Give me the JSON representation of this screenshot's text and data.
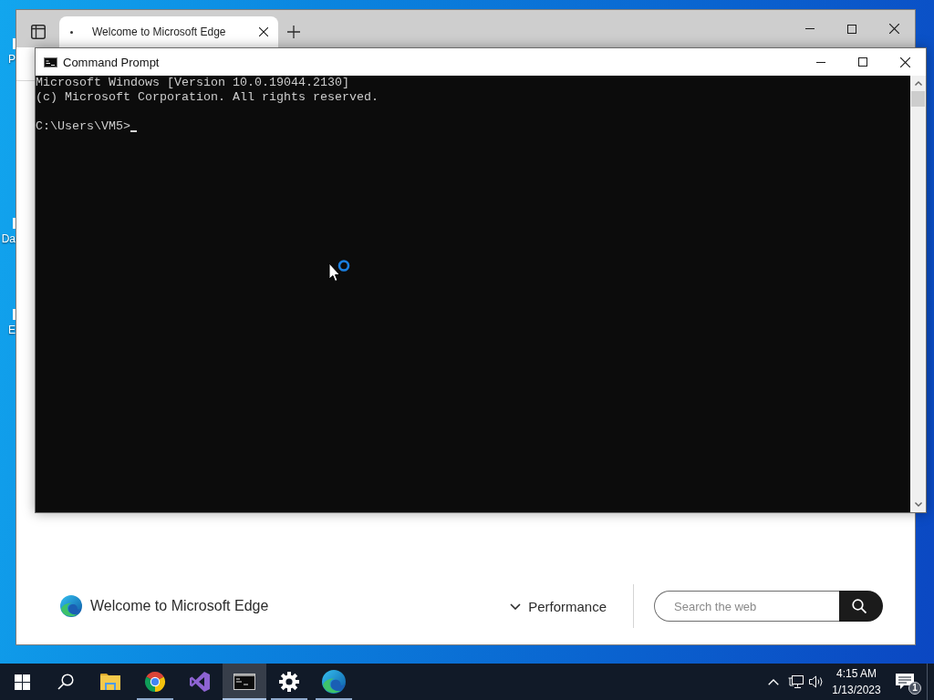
{
  "desktop": {
    "icons": [
      {
        "label": "P"
      },
      {
        "label": "Da"
      },
      {
        "label": "E"
      }
    ]
  },
  "browser": {
    "tabs": [
      {
        "title": "Welcome to Microsoft Edge",
        "selected": true
      }
    ],
    "page": {
      "brand": "Welcome to Microsoft Edge",
      "menu": "Performance",
      "search": {
        "placeholder": "Search the web"
      }
    }
  },
  "console": {
    "title": "Command Prompt",
    "output": [
      "Microsoft Windows [Version 10.0.19044.2130]",
      "(c) Microsoft Corporation. All rights reserved."
    ],
    "prompt": "C:\\Users\\VM5>"
  },
  "taskbar": {
    "apps": [
      {
        "kind": "folder",
        "running": false,
        "selected": false
      },
      {
        "kind": "chrome",
        "running": true,
        "selected": false
      },
      {
        "kind": "studio",
        "running": false,
        "selected": false
      },
      {
        "kind": "terminal",
        "running": true,
        "selected": true
      },
      {
        "kind": "gear",
        "running": true,
        "selected": false
      },
      {
        "kind": "edge",
        "running": true,
        "selected": false
      }
    ],
    "clock": {
      "time": "4:15 AM",
      "date": "1/13/2023"
    },
    "notifications": {
      "count": "1"
    }
  }
}
